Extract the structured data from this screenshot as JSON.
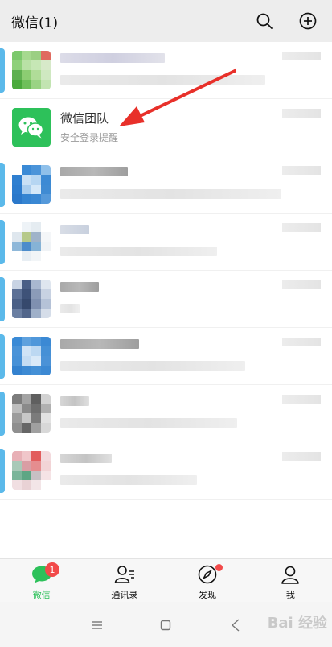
{
  "header": {
    "title": "微信(1)",
    "icons": [
      "search-icon",
      "add-icon"
    ]
  },
  "pinned_chat": {
    "name": "微信团队",
    "preview": "安全登录提醒"
  },
  "tabs": [
    {
      "label": "微信",
      "icon": "chat-icon",
      "badge": "1",
      "active": true
    },
    {
      "label": "通讯录",
      "icon": "contacts-icon",
      "active": false
    },
    {
      "label": "发现",
      "icon": "discover-icon",
      "dot": true,
      "active": false
    },
    {
      "label": "我",
      "icon": "me-icon",
      "active": false
    }
  ],
  "system_nav": [
    "menu-icon",
    "home-icon",
    "back-icon"
  ],
  "watermark": "Bai 经验",
  "colors": {
    "wechat_green": "#2dc15a",
    "badge_red": "#f24a4a",
    "arrow_red": "#e8302a"
  }
}
